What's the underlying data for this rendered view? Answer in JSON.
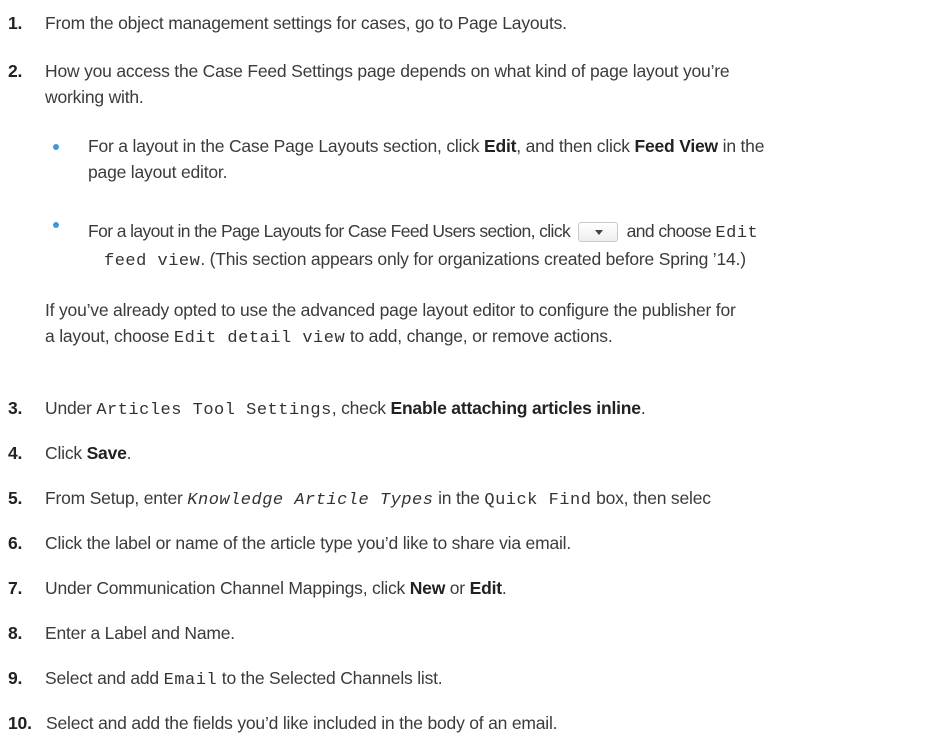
{
  "steps": [
    {
      "num": "1.",
      "parts": [
        "From the object management settings for cases, go to Page Layouts."
      ]
    },
    {
      "num": "2.",
      "line1": "How you access the Case Feed Settings page depends on what kind of page layout you’re",
      "line2": "working with."
    },
    {
      "num": "3.",
      "a": "Under ",
      "code": "Articles Tool Settings",
      "b": ", check ",
      "bold": "Enable attaching articles inline",
      "c": "."
    },
    {
      "num": "4.",
      "a": "Click ",
      "bold": "Save",
      "b": "."
    },
    {
      "num": "5.",
      "a": "From Setup, enter ",
      "code_it": "Knowledge Article Types",
      "b": " in the ",
      "code": "Quick Find",
      "c": " box, then selec"
    },
    {
      "num": "6.",
      "a": "Click the label or name of the article type you’d like to share via email."
    },
    {
      "num": "7.",
      "a": "Under Communication Channel Mappings, click ",
      "bold1": "New",
      "b": " or ",
      "bold2": "Edit",
      "c": "."
    },
    {
      "num": "8.",
      "a": "Enter a Label and Name."
    },
    {
      "num": "9.",
      "a": "Select and add ",
      "code": "Email",
      "b": " to the Selected Channels list."
    },
    {
      "num": "10.",
      "a": "Select and add the fields you’d like included in the body of an email."
    }
  ],
  "bullets": [
    {
      "l1a": "For a layout in the Case Page Layouts section, click ",
      "l1bold1": "Edit",
      "l1b": ", and then click ",
      "l1bold2": "Feed View",
      "l1c": " in the",
      "l2": "page layout editor."
    },
    {
      "l1a": "For a layout in the Page Layouts for Case Feed Users section, click ",
      "l1b": " and choose ",
      "l1code": "Edit",
      "l2code": "feed view",
      "l2": ". (This section appears only for organizations created before Spring ’14.)"
    }
  ],
  "note": {
    "line1": "If you’ve already opted to use the advanced page layout editor to configure the publisher for",
    "line2a": "a layout, choose ",
    "line2code": "Edit detail view",
    "line2b": " to add, change, or remove actions."
  },
  "colors": {
    "bullet": "#3c9bd6",
    "text": "#3b3b3b"
  }
}
